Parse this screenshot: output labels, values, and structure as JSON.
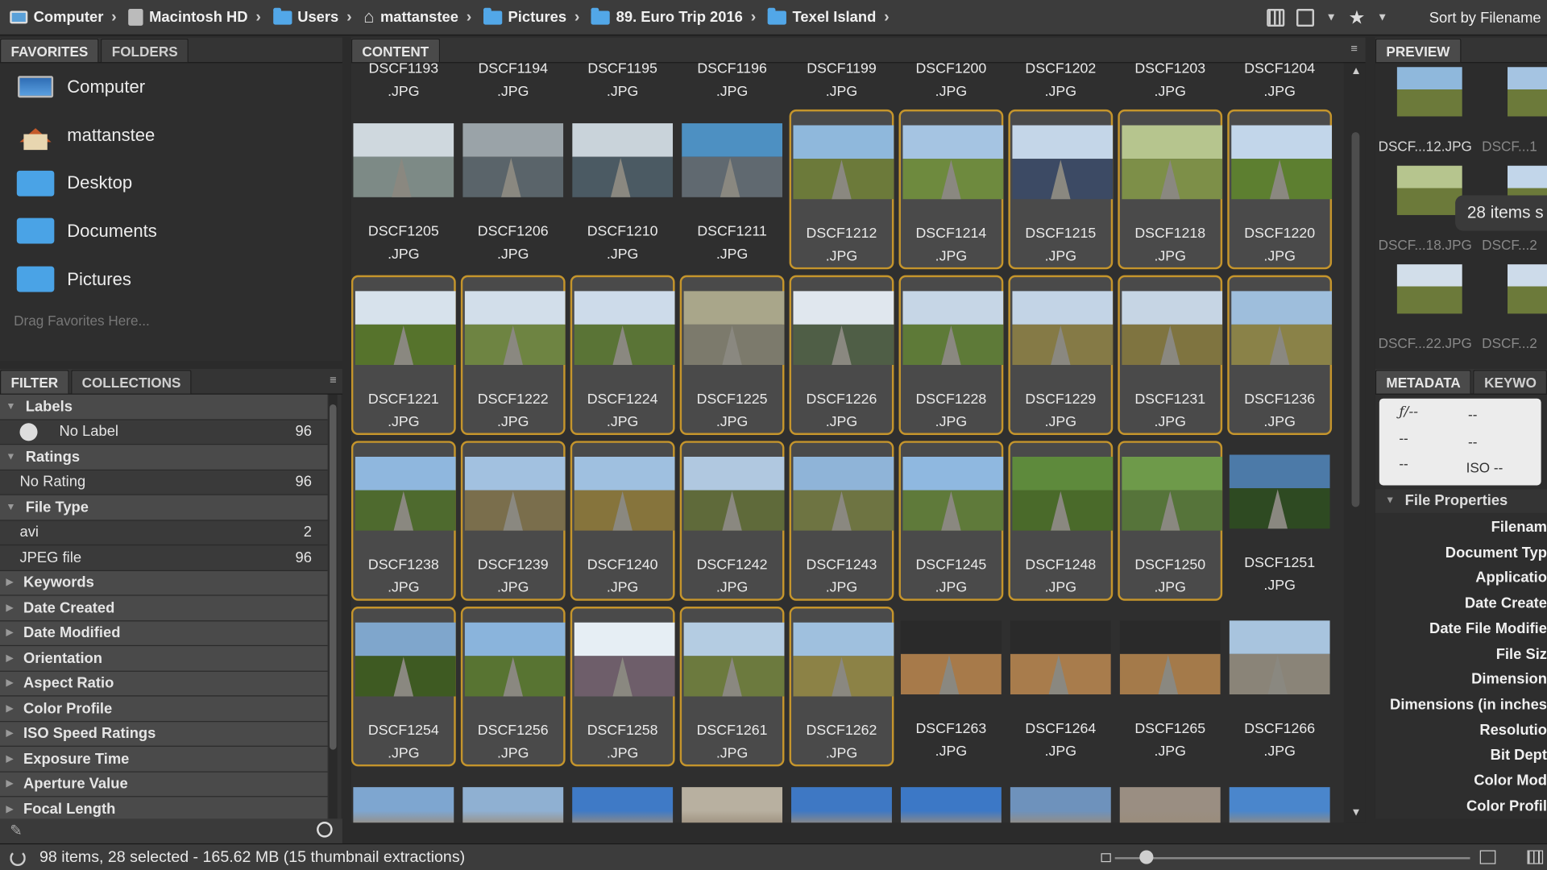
{
  "breadcrumb": [
    {
      "label": "Computer",
      "icon": "computer-icon"
    },
    {
      "label": "Macintosh HD",
      "icon": "disk-icon"
    },
    {
      "label": "Users",
      "icon": "folder-icon"
    },
    {
      "label": "mattanstee",
      "icon": "home-icon"
    },
    {
      "label": "Pictures",
      "icon": "folder-icon"
    },
    {
      "label": "89. Euro Trip 2016",
      "icon": "folder-icon"
    },
    {
      "label": "Texel Island",
      "icon": "folder-icon"
    }
  ],
  "toolbar": {
    "sort_label": "Sort by Filename"
  },
  "left_tabs": {
    "favorites": "FAVORITES",
    "folders": "FOLDERS"
  },
  "favorites": [
    {
      "label": "Computer",
      "icon": "computer-icon"
    },
    {
      "label": "mattanstee",
      "icon": "home-icon"
    },
    {
      "label": "Desktop",
      "icon": "folder-icon"
    },
    {
      "label": "Documents",
      "icon": "folder-icon"
    },
    {
      "label": "Pictures",
      "icon": "folder-icon"
    }
  ],
  "favorites_hint": "Drag Favorites Here...",
  "filter_tabs": {
    "filter": "FILTER",
    "collections": "COLLECTIONS"
  },
  "filters": [
    {
      "kind": "head",
      "label": "Labels",
      "expanded": true
    },
    {
      "kind": "value",
      "label": "No Label",
      "count": "96",
      "icon": "no-label-icon"
    },
    {
      "kind": "head",
      "label": "Ratings",
      "expanded": true
    },
    {
      "kind": "value",
      "label": "No Rating",
      "count": "96"
    },
    {
      "kind": "head",
      "label": "File Type",
      "expanded": true
    },
    {
      "kind": "value",
      "label": "avi",
      "count": "2"
    },
    {
      "kind": "value",
      "label": "JPEG file",
      "count": "96"
    },
    {
      "kind": "head",
      "label": "Keywords"
    },
    {
      "kind": "head",
      "label": "Date Created"
    },
    {
      "kind": "head",
      "label": "Date Modified"
    },
    {
      "kind": "head",
      "label": "Orientation"
    },
    {
      "kind": "head",
      "label": "Aspect Ratio"
    },
    {
      "kind": "head",
      "label": "Color Profile"
    },
    {
      "kind": "head",
      "label": "ISO Speed Ratings"
    },
    {
      "kind": "head",
      "label": "Exposure Time"
    },
    {
      "kind": "head",
      "label": "Aperture Value"
    },
    {
      "kind": "head",
      "label": "Focal Length"
    }
  ],
  "content_tab": "CONTENT",
  "top_row": [
    "DSCF1193",
    "DSCF1194",
    "DSCF1195",
    "DSCF1196",
    "DSCF1199",
    "DSCF1200",
    "DSCF1202",
    "DSCF1203",
    "DSCF1204"
  ],
  "ext": ".JPG",
  "thumbnails": [
    {
      "name": "DSCF1205",
      "selected": false,
      "sky": "#cfd8de",
      "gnd": "#7d8a86"
    },
    {
      "name": "DSCF1206",
      "selected": false,
      "sky": "#9aa3a8",
      "gnd": "#5a646a"
    },
    {
      "name": "DSCF1210",
      "selected": false,
      "sky": "#c9d3da",
      "gnd": "#4b5a63"
    },
    {
      "name": "DSCF1211",
      "selected": false,
      "sky": "#4d90c2",
      "gnd": "#606970"
    },
    {
      "name": "DSCF1212",
      "selected": true,
      "sky": "#8fb8dc",
      "gnd": "#6c7a3a"
    },
    {
      "name": "DSCF1214",
      "selected": true,
      "sky": "#a5c4e2",
      "gnd": "#6e8a3e"
    },
    {
      "name": "DSCF1215",
      "selected": true,
      "sky": "#c4d6e8",
      "gnd": "#3c4a64"
    },
    {
      "name": "DSCF1218",
      "selected": true,
      "sky": "#b6c58e",
      "gnd": "#7d8f48"
    },
    {
      "name": "DSCF1220",
      "selected": true,
      "sky": "#c2d6ea",
      "gnd": "#5d7f30"
    },
    {
      "name": "DSCF1221",
      "selected": true,
      "sky": "#d7e2ec",
      "gnd": "#56732c"
    },
    {
      "name": "DSCF1222",
      "selected": true,
      "sky": "#d2deea",
      "gnd": "#6e8442"
    },
    {
      "name": "DSCF1224",
      "selected": true,
      "sky": "#cddbea",
      "gnd": "#5a7436"
    },
    {
      "name": "DSCF1225",
      "selected": true,
      "sky": "#a9a68a",
      "gnd": "#7c7a6c"
    },
    {
      "name": "DSCF1226",
      "selected": true,
      "sky": "#e0e7ee",
      "gnd": "#4f5e46"
    },
    {
      "name": "DSCF1228",
      "selected": true,
      "sky": "#c6d6e6",
      "gnd": "#5e7a38"
    },
    {
      "name": "DSCF1229",
      "selected": true,
      "sky": "#c3d4e6",
      "gnd": "#857a46"
    },
    {
      "name": "DSCF1231",
      "selected": true,
      "sky": "#c6d5e4",
      "gnd": "#7f7440"
    },
    {
      "name": "DSCF1236",
      "selected": true,
      "sky": "#9ebedc",
      "gnd": "#8a8248"
    },
    {
      "name": "DSCF1238",
      "selected": true,
      "sky": "#8fb7de",
      "gnd": "#4e6a2e"
    },
    {
      "name": "DSCF1239",
      "selected": true,
      "sky": "#a2c1e0",
      "gnd": "#7a6e4c"
    },
    {
      "name": "DSCF1240",
      "selected": true,
      "sky": "#9fc0e0",
      "gnd": "#86743c"
    },
    {
      "name": "DSCF1242",
      "selected": true,
      "sky": "#b0c8e0",
      "gnd": "#5f6a3a"
    },
    {
      "name": "DSCF1243",
      "selected": true,
      "sky": "#8fb4d8",
      "gnd": "#6e7442"
    },
    {
      "name": "DSCF1245",
      "selected": true,
      "sky": "#8fb8e0",
      "gnd": "#5f7a3a"
    },
    {
      "name": "DSCF1248",
      "selected": true,
      "sky": "#5e8a3c",
      "gnd": "#4a6a2a"
    },
    {
      "name": "DSCF1250",
      "selected": true,
      "sky": "#6e9a4a",
      "gnd": "#56743a"
    },
    {
      "name": "DSCF1251",
      "selected": false,
      "sky": "#4c7aa8",
      "gnd": "#2e4a22"
    },
    {
      "name": "DSCF1254",
      "selected": true,
      "sky": "#7fa6cc",
      "gnd": "#3e5a22"
    },
    {
      "name": "DSCF1256",
      "selected": true,
      "sky": "#8ab4dc",
      "gnd": "#587432"
    },
    {
      "name": "DSCF1258",
      "selected": true,
      "sky": "#e6eef4",
      "gnd": "#6e5e6a"
    },
    {
      "name": "DSCF1261",
      "selected": true,
      "sky": "#b4cce2",
      "gnd": "#6c7a3e"
    },
    {
      "name": "DSCF1262",
      "selected": true,
      "sky": "#9fc0de",
      "gnd": "#8c8246"
    },
    {
      "name": "DSCF1263",
      "selected": false,
      "sky": "#2a2a2a",
      "gnd": "#a77a4a"
    },
    {
      "name": "DSCF1264",
      "selected": false,
      "sky": "#2a2a2a",
      "gnd": "#a87c4c"
    },
    {
      "name": "DSCF1265",
      "selected": false,
      "sky": "#2a2a2a",
      "gnd": "#a47a4a"
    },
    {
      "name": "DSCF1266",
      "selected": false,
      "sky": "#a8c4de",
      "gnd": "#8a8478"
    }
  ],
  "bottom_partial": [
    "#7ea6d0",
    "#8fb0d2",
    "#3f7ac6",
    "#b8b0a0",
    "#3e78c4",
    "#3c78c6",
    "#6e92bc",
    "#9a8e82",
    "#4a86cc"
  ],
  "preview": {
    "tab": "PREVIEW",
    "names": [
      "DSCF...12.JPG",
      "DSCF...1",
      "DSCF...18.JPG",
      "DSCF...2",
      "DSCF...22.JPG",
      "DSCF...2"
    ],
    "badge": "28 items s"
  },
  "metadata": {
    "tabs": [
      "METADATA",
      "KEYWO"
    ],
    "aperture": "ƒ/--",
    "values": [
      "--",
      "--",
      "--",
      "--"
    ],
    "iso": "ISO --",
    "section": "File Properties",
    "labels": [
      "Filenam",
      "Document Typ",
      "Applicatio",
      "Date Create",
      "Date File Modifie",
      "File Siz",
      "Dimension",
      "Dimensions (in inches",
      "Resolutio",
      "Bit Dept",
      "Color Mod",
      "Color Profil"
    ]
  },
  "status": {
    "text": "98 items, 28 selected - 165.62 MB (15 thumbnail extractions)",
    "thumb_size_fraction": 0.09
  }
}
